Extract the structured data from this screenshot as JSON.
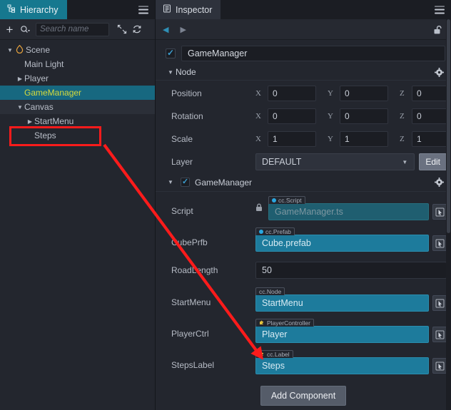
{
  "hierarchy": {
    "tab_label": "Hierarchy",
    "tab_icon": "hierarchy-icon",
    "menu_icon": "hamburger-menu-icon",
    "toolbar": {
      "add_label": "+",
      "search_icon": "search-dropdown-icon",
      "search_value": "",
      "search_placeholder": "Search name",
      "collapse_icon": "collapse-all-icon",
      "refresh_icon": "refresh-icon"
    },
    "items": [
      {
        "label": "Scene",
        "indent": 0,
        "caret": "down",
        "icon": "scene-flame-icon",
        "state": "normal"
      },
      {
        "label": "Main Light",
        "indent": 1,
        "caret": "none",
        "icon": "",
        "state": "normal"
      },
      {
        "label": "Player",
        "indent": 1,
        "caret": "right",
        "icon": "",
        "state": "normal"
      },
      {
        "label": "GameManager",
        "indent": 1,
        "caret": "none",
        "icon": "",
        "state": "selected"
      },
      {
        "label": "Canvas",
        "indent": 1,
        "caret": "down",
        "icon": "",
        "state": "hover"
      },
      {
        "label": "StartMenu",
        "indent": 2,
        "caret": "right",
        "icon": "",
        "state": "normal"
      },
      {
        "label": "Steps",
        "indent": 2,
        "caret": "none",
        "icon": "",
        "state": "normal"
      }
    ]
  },
  "inspector": {
    "tab_label": "Inspector",
    "tab_icon": "inspector-icon",
    "menu_icon": "hamburger-menu-icon",
    "nav": {
      "back_icon": "nav-back-icon",
      "forward_icon": "nav-forward-icon",
      "lock_icon": "lock-open-icon"
    },
    "node_name": "GameManager",
    "node_enabled": true,
    "node_section": {
      "title": "Node",
      "gear_icon": "gear-icon",
      "transform_rows": [
        {
          "label": "Position",
          "x": "0",
          "y": "0",
          "z": "0"
        },
        {
          "label": "Rotation",
          "x": "0",
          "y": "0",
          "z": "0"
        },
        {
          "label": "Scale",
          "x": "1",
          "y": "1",
          "z": "1"
        }
      ],
      "axis_labels": [
        "X",
        "Y",
        "Z"
      ],
      "layer": {
        "label": "Layer",
        "value": "DEFAULT",
        "dropdown_icon": "chevron-down-icon",
        "edit_label": "Edit"
      }
    },
    "component": {
      "title": "GameManager",
      "enabled": true,
      "gear_icon": "gear-icon",
      "properties": [
        {
          "label": "Script",
          "kind": "object",
          "style": "dim",
          "badge_text": "cc.Script",
          "badge_icon": "blue-dot-icon",
          "value": "GameManager.ts",
          "locked": true,
          "picker_icon": "node-picker-icon"
        },
        {
          "label": "CubePrfb",
          "kind": "object",
          "style": "filled",
          "badge_text": "cc.Prefab",
          "badge_icon": "blue-dot-icon",
          "value": "Cube.prefab",
          "locked": false,
          "picker_icon": "node-picker-icon"
        },
        {
          "label": "RoadLength",
          "kind": "number",
          "value": "50"
        },
        {
          "label": "StartMenu",
          "kind": "object",
          "style": "filled",
          "badge_text": "cc.Node",
          "badge_icon": "none",
          "value": "StartMenu",
          "locked": false,
          "picker_icon": "node-picker-icon"
        },
        {
          "label": "PlayerCtrl",
          "kind": "object",
          "style": "filled",
          "badge_text": "PlayerController",
          "badge_icon": "puzzle-icon",
          "value": "Player",
          "locked": false,
          "picker_icon": "node-picker-icon"
        },
        {
          "label": "StepsLabel",
          "kind": "object",
          "style": "filled",
          "badge_text": "cc.Label",
          "badge_icon": "puzzle-icon",
          "value": "Steps",
          "locked": false,
          "picker_icon": "node-picker-icon"
        }
      ]
    },
    "add_component_label": "Add Component"
  },
  "annotations": {
    "highlight_color": "#fb1b1b",
    "highlight_target": "Steps",
    "arrow_from": "hierarchy Steps node",
    "arrow_to": "StepsLabel property field"
  }
}
